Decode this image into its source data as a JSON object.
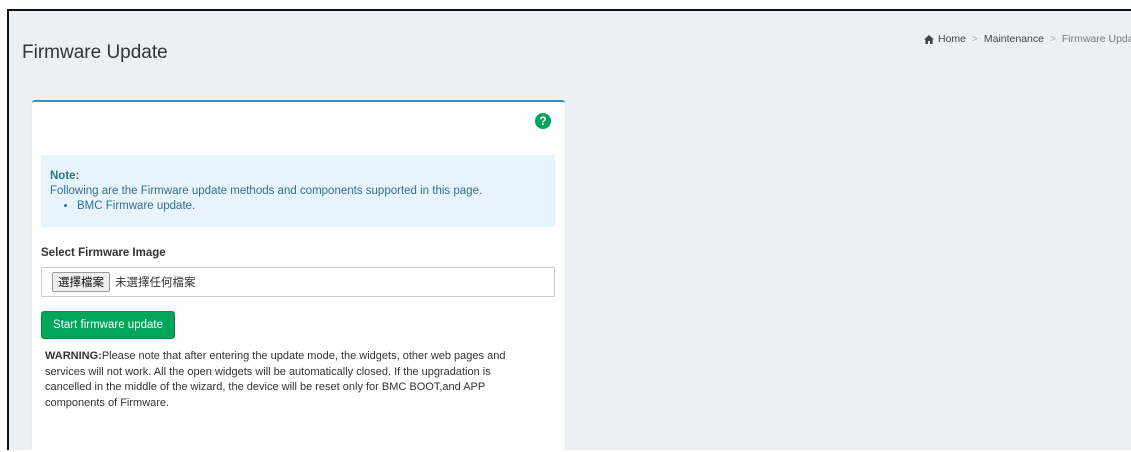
{
  "header": {
    "title": "Firmware Update"
  },
  "breadcrumb": {
    "home": "Home",
    "section": "Maintenance",
    "current": "Firmware Update",
    "separator": ">"
  },
  "panel": {
    "help_icon": "question-circle-icon",
    "help_glyph": "?",
    "note": {
      "title": "Note:",
      "text": "Following are the Firmware update methods and components supported in this page.",
      "items": [
        "BMC Firmware update."
      ]
    },
    "select_label": "Select Firmware Image",
    "file_input": {
      "button_label": "選擇檔案",
      "status": "未選擇任何檔案"
    },
    "start_button": "Start firmware update",
    "warning": {
      "prefix": "WARNING:",
      "text": "Please note that after entering the update mode, the widgets, other web pages and services will not work. All the open widgets will be automatically closed. If the upgradation is cancelled in the middle of the wizard, the device will be reset only for BMC BOOT,and APP components of Firmware."
    }
  },
  "colors": {
    "accent": "#3c8dbc",
    "success": "#00a65a",
    "note_bg": "#e8f4fb",
    "note_text": "#31708f",
    "background": "#ecf0f5"
  }
}
